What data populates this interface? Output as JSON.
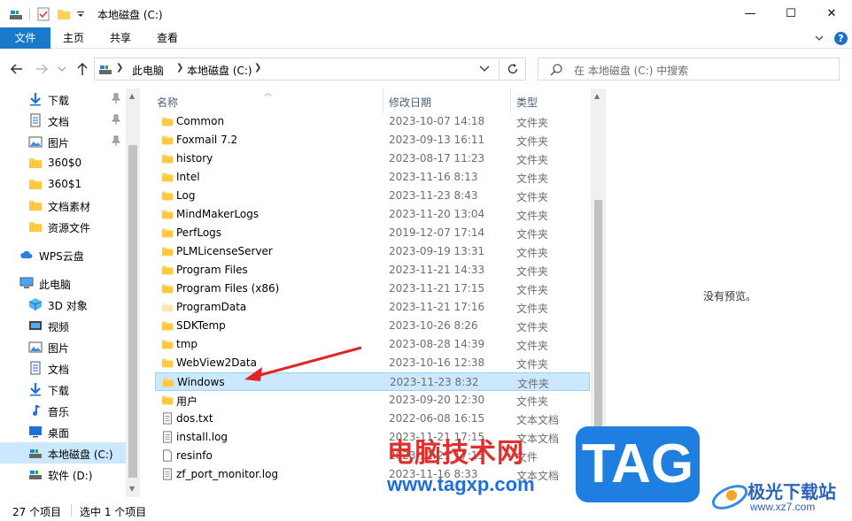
{
  "window": {
    "title": "本地磁盘 (C:)",
    "minimize": "—",
    "maximize": "☐",
    "close": "✕"
  },
  "ribbon": {
    "tabs": [
      "文件",
      "主页",
      "共享",
      "查看"
    ],
    "help": "?"
  },
  "address": {
    "segments": [
      "此电脑",
      "本地磁盘 (C:)"
    ]
  },
  "search": {
    "placeholder": "在 本地磁盘 (C:) 中搜索"
  },
  "sidebar": {
    "items": [
      {
        "label": "下载",
        "icon": "download-arrow-icon",
        "pinned": true
      },
      {
        "label": "文档",
        "icon": "document-icon",
        "pinned": true
      },
      {
        "label": "图片",
        "icon": "pictures-icon",
        "pinned": true
      },
      {
        "label": "360$0",
        "icon": "folder-icon"
      },
      {
        "label": "360$1",
        "icon": "folder-icon"
      },
      {
        "label": "文档素材",
        "icon": "folder-icon"
      },
      {
        "label": "资源文件",
        "icon": "folder-icon"
      },
      {
        "label": "WPS云盘",
        "icon": "cloud-icon"
      },
      {
        "label": "此电脑",
        "icon": "computer-icon"
      },
      {
        "label": "3D 对象",
        "icon": "3d-objects-icon"
      },
      {
        "label": "视频",
        "icon": "videos-icon"
      },
      {
        "label": "图片",
        "icon": "pictures-icon"
      },
      {
        "label": "文档",
        "icon": "document-icon"
      },
      {
        "label": "下载",
        "icon": "download-arrow-icon"
      },
      {
        "label": "音乐",
        "icon": "music-icon"
      },
      {
        "label": "桌面",
        "icon": "desktop-icon"
      },
      {
        "label": "本地磁盘 (C:)",
        "icon": "drive-icon",
        "selected": true
      },
      {
        "label": "软件 (D:)",
        "icon": "drive-icon"
      }
    ]
  },
  "columns": {
    "name": "名称",
    "date": "修改日期",
    "type": "类型"
  },
  "files": [
    {
      "name": "Common",
      "date": "2023-10-07 14:18",
      "type": "文件夹",
      "kind": "folder"
    },
    {
      "name": "Foxmail 7.2",
      "date": "2023-09-13 16:11",
      "type": "文件夹",
      "kind": "folder"
    },
    {
      "name": "history",
      "date": "2023-08-17 11:23",
      "type": "文件夹",
      "kind": "folder"
    },
    {
      "name": "Intel",
      "date": "2023-11-16 8:13",
      "type": "文件夹",
      "kind": "folder"
    },
    {
      "name": "Log",
      "date": "2023-11-23 8:43",
      "type": "文件夹",
      "kind": "folder"
    },
    {
      "name": "MindMakerLogs",
      "date": "2023-11-20 13:04",
      "type": "文件夹",
      "kind": "folder"
    },
    {
      "name": "PerfLogs",
      "date": "2019-12-07 17:14",
      "type": "文件夹",
      "kind": "folder"
    },
    {
      "name": "PLMLicenseServer",
      "date": "2023-09-19 13:31",
      "type": "文件夹",
      "kind": "folder"
    },
    {
      "name": "Program Files",
      "date": "2023-11-21 14:33",
      "type": "文件夹",
      "kind": "folder"
    },
    {
      "name": "Program Files (x86)",
      "date": "2023-11-21 17:15",
      "type": "文件夹",
      "kind": "folder"
    },
    {
      "name": "ProgramData",
      "date": "2023-11-21 17:16",
      "type": "文件夹",
      "kind": "folder-hidden"
    },
    {
      "name": "SDKTemp",
      "date": "2023-10-26 8:26",
      "type": "文件夹",
      "kind": "folder"
    },
    {
      "name": "tmp",
      "date": "2023-08-28 14:39",
      "type": "文件夹",
      "kind": "folder"
    },
    {
      "name": "WebView2Data",
      "date": "2023-10-16 12:38",
      "type": "文件夹",
      "kind": "folder"
    },
    {
      "name": "Windows",
      "date": "2023-11-23 8:32",
      "type": "文件夹",
      "kind": "folder",
      "selected": true
    },
    {
      "name": "用户",
      "date": "2023-09-20 12:30",
      "type": "文件夹",
      "kind": "folder"
    },
    {
      "name": "dos.txt",
      "date": "2022-06-08 16:15",
      "type": "文本文档",
      "kind": "text"
    },
    {
      "name": "install.log",
      "date": "2023-11-21 17:15",
      "type": "文本文档",
      "kind": "text"
    },
    {
      "name": "resinfo",
      "date": "2023-11-21 17:15",
      "type": "文件",
      "kind": "file"
    },
    {
      "name": "zf_port_monitor.log",
      "date": "2023-11-16 8:33",
      "type": "文本文档",
      "kind": "text"
    }
  ],
  "preview": {
    "empty_text": "没有预览。"
  },
  "status": {
    "count": "27 个项目",
    "selection": "选中 1 个项目"
  },
  "watermark": {
    "site_name": "电脑技术网",
    "site_url": "www.tagxp.com",
    "badge": "TAG",
    "logo_name": "极光下载站",
    "logo_url": "www.xz7.com"
  },
  "colors": {
    "accent": "#1979ca",
    "selection": "#cce8ff",
    "folder": "#ffd35b",
    "annotation_arrow": "#e02424"
  }
}
